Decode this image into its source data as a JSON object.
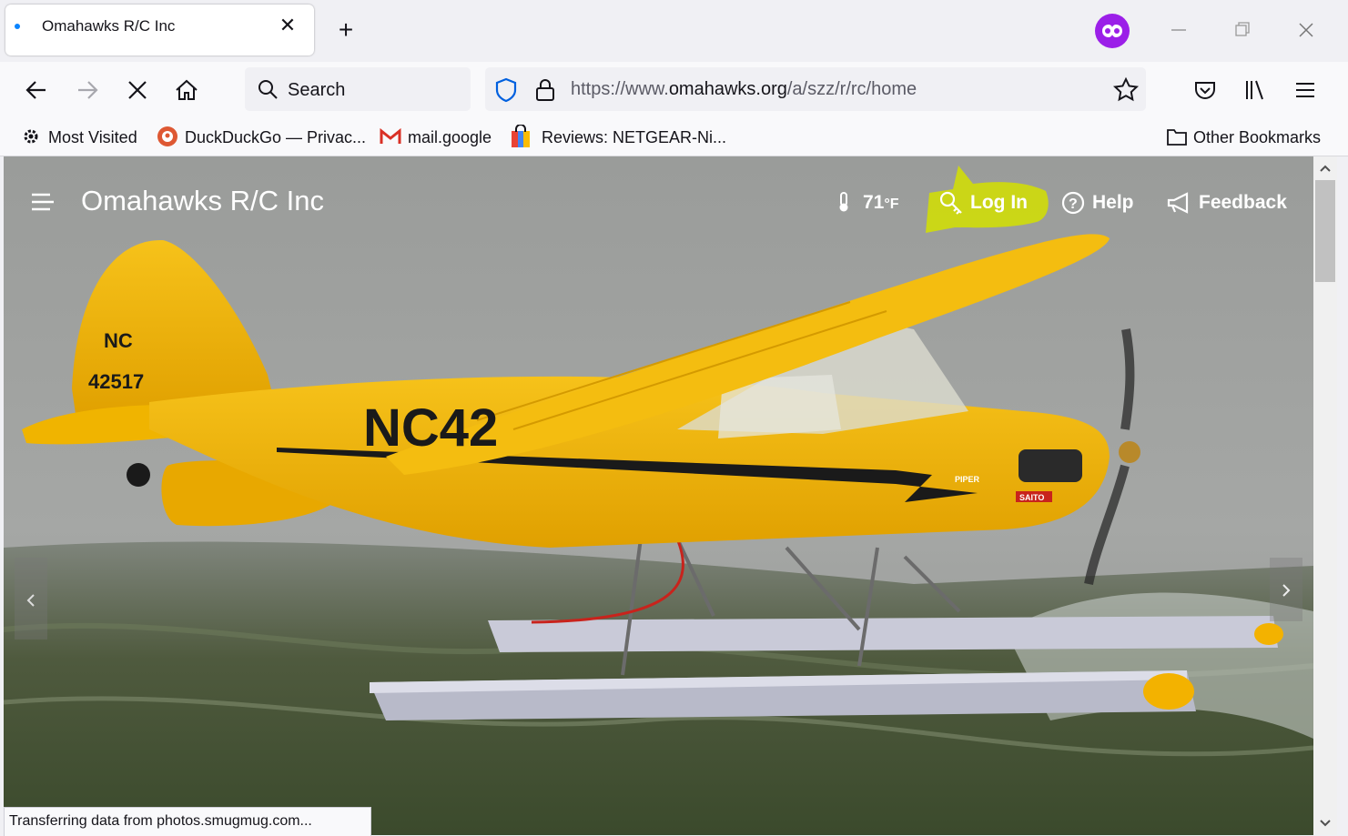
{
  "browser": {
    "tab_title": "Omahawks R/C Inc",
    "search_placeholder": "Search",
    "url_prefix": "https://www.",
    "url_domain": "omahawks.org",
    "url_path": "/a/szz/r/rc/home",
    "status_text": "Transferring data from photos.smugmug.com...",
    "accent_color": "#0a84ff",
    "extension_color": "#9b1fe8"
  },
  "bookmarks": {
    "most_visited": "Most Visited",
    "duckduckgo": "DuckDuckGo — Privac...",
    "gmail": "mail.google",
    "netgear": "Reviews: NETGEAR-Ni...",
    "other": "Other Bookmarks"
  },
  "site": {
    "title": "Omahawks R/C Inc",
    "temperature": "71",
    "temperature_unit": "°F",
    "login": "Log In",
    "help": "Help",
    "feedback": "Feedback",
    "highlight_color": "#d4e000"
  },
  "photo": {
    "tail_text_1": "NC",
    "tail_text_2": "42517",
    "fuselage_text": "NC42",
    "cowl_text": "PIPER",
    "engine_text": "SAITO",
    "plane_color": "#f3b200"
  }
}
